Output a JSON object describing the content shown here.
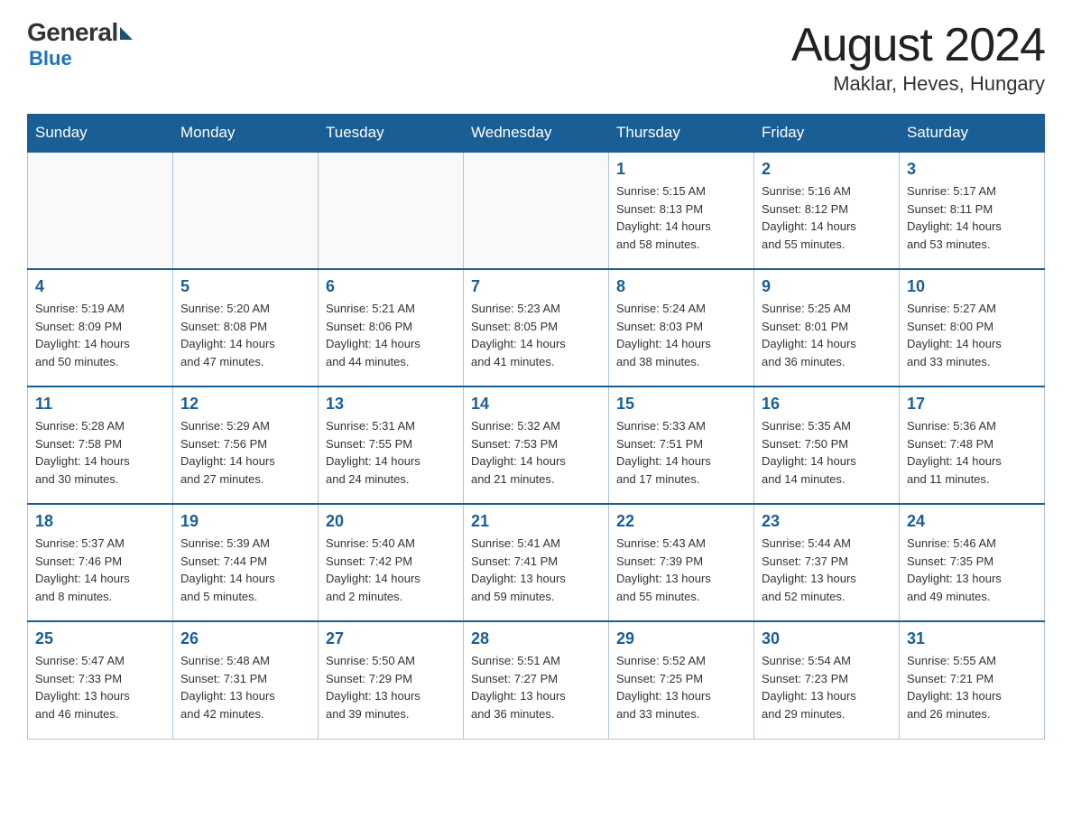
{
  "header": {
    "logo": {
      "general": "General",
      "blue": "Blue"
    },
    "month_year": "August 2024",
    "location": "Maklar, Heves, Hungary"
  },
  "days_of_week": [
    "Sunday",
    "Monday",
    "Tuesday",
    "Wednesday",
    "Thursday",
    "Friday",
    "Saturday"
  ],
  "weeks": [
    [
      {
        "day": "",
        "info": ""
      },
      {
        "day": "",
        "info": ""
      },
      {
        "day": "",
        "info": ""
      },
      {
        "day": "",
        "info": ""
      },
      {
        "day": "1",
        "info": "Sunrise: 5:15 AM\nSunset: 8:13 PM\nDaylight: 14 hours\nand 58 minutes."
      },
      {
        "day": "2",
        "info": "Sunrise: 5:16 AM\nSunset: 8:12 PM\nDaylight: 14 hours\nand 55 minutes."
      },
      {
        "day": "3",
        "info": "Sunrise: 5:17 AM\nSunset: 8:11 PM\nDaylight: 14 hours\nand 53 minutes."
      }
    ],
    [
      {
        "day": "4",
        "info": "Sunrise: 5:19 AM\nSunset: 8:09 PM\nDaylight: 14 hours\nand 50 minutes."
      },
      {
        "day": "5",
        "info": "Sunrise: 5:20 AM\nSunset: 8:08 PM\nDaylight: 14 hours\nand 47 minutes."
      },
      {
        "day": "6",
        "info": "Sunrise: 5:21 AM\nSunset: 8:06 PM\nDaylight: 14 hours\nand 44 minutes."
      },
      {
        "day": "7",
        "info": "Sunrise: 5:23 AM\nSunset: 8:05 PM\nDaylight: 14 hours\nand 41 minutes."
      },
      {
        "day": "8",
        "info": "Sunrise: 5:24 AM\nSunset: 8:03 PM\nDaylight: 14 hours\nand 38 minutes."
      },
      {
        "day": "9",
        "info": "Sunrise: 5:25 AM\nSunset: 8:01 PM\nDaylight: 14 hours\nand 36 minutes."
      },
      {
        "day": "10",
        "info": "Sunrise: 5:27 AM\nSunset: 8:00 PM\nDaylight: 14 hours\nand 33 minutes."
      }
    ],
    [
      {
        "day": "11",
        "info": "Sunrise: 5:28 AM\nSunset: 7:58 PM\nDaylight: 14 hours\nand 30 minutes."
      },
      {
        "day": "12",
        "info": "Sunrise: 5:29 AM\nSunset: 7:56 PM\nDaylight: 14 hours\nand 27 minutes."
      },
      {
        "day": "13",
        "info": "Sunrise: 5:31 AM\nSunset: 7:55 PM\nDaylight: 14 hours\nand 24 minutes."
      },
      {
        "day": "14",
        "info": "Sunrise: 5:32 AM\nSunset: 7:53 PM\nDaylight: 14 hours\nand 21 minutes."
      },
      {
        "day": "15",
        "info": "Sunrise: 5:33 AM\nSunset: 7:51 PM\nDaylight: 14 hours\nand 17 minutes."
      },
      {
        "day": "16",
        "info": "Sunrise: 5:35 AM\nSunset: 7:50 PM\nDaylight: 14 hours\nand 14 minutes."
      },
      {
        "day": "17",
        "info": "Sunrise: 5:36 AM\nSunset: 7:48 PM\nDaylight: 14 hours\nand 11 minutes."
      }
    ],
    [
      {
        "day": "18",
        "info": "Sunrise: 5:37 AM\nSunset: 7:46 PM\nDaylight: 14 hours\nand 8 minutes."
      },
      {
        "day": "19",
        "info": "Sunrise: 5:39 AM\nSunset: 7:44 PM\nDaylight: 14 hours\nand 5 minutes."
      },
      {
        "day": "20",
        "info": "Sunrise: 5:40 AM\nSunset: 7:42 PM\nDaylight: 14 hours\nand 2 minutes."
      },
      {
        "day": "21",
        "info": "Sunrise: 5:41 AM\nSunset: 7:41 PM\nDaylight: 13 hours\nand 59 minutes."
      },
      {
        "day": "22",
        "info": "Sunrise: 5:43 AM\nSunset: 7:39 PM\nDaylight: 13 hours\nand 55 minutes."
      },
      {
        "day": "23",
        "info": "Sunrise: 5:44 AM\nSunset: 7:37 PM\nDaylight: 13 hours\nand 52 minutes."
      },
      {
        "day": "24",
        "info": "Sunrise: 5:46 AM\nSunset: 7:35 PM\nDaylight: 13 hours\nand 49 minutes."
      }
    ],
    [
      {
        "day": "25",
        "info": "Sunrise: 5:47 AM\nSunset: 7:33 PM\nDaylight: 13 hours\nand 46 minutes."
      },
      {
        "day": "26",
        "info": "Sunrise: 5:48 AM\nSunset: 7:31 PM\nDaylight: 13 hours\nand 42 minutes."
      },
      {
        "day": "27",
        "info": "Sunrise: 5:50 AM\nSunset: 7:29 PM\nDaylight: 13 hours\nand 39 minutes."
      },
      {
        "day": "28",
        "info": "Sunrise: 5:51 AM\nSunset: 7:27 PM\nDaylight: 13 hours\nand 36 minutes."
      },
      {
        "day": "29",
        "info": "Sunrise: 5:52 AM\nSunset: 7:25 PM\nDaylight: 13 hours\nand 33 minutes."
      },
      {
        "day": "30",
        "info": "Sunrise: 5:54 AM\nSunset: 7:23 PM\nDaylight: 13 hours\nand 29 minutes."
      },
      {
        "day": "31",
        "info": "Sunrise: 5:55 AM\nSunset: 7:21 PM\nDaylight: 13 hours\nand 26 minutes."
      }
    ]
  ]
}
